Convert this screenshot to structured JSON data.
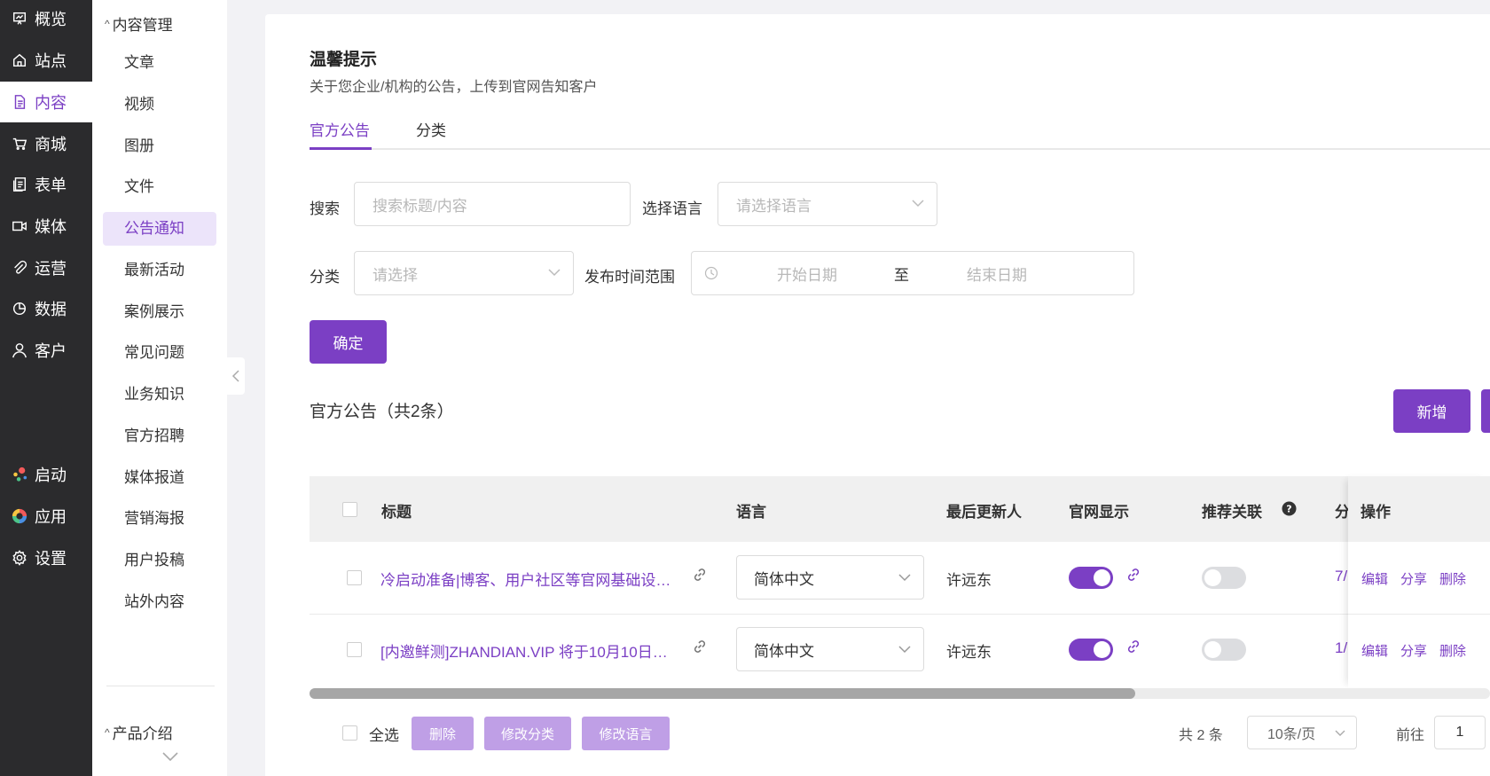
{
  "nav": {
    "items": [
      {
        "label": "概览",
        "icon": "presentation-icon"
      },
      {
        "label": "站点",
        "icon": "home-icon"
      },
      {
        "label": "内容",
        "icon": "document-icon"
      },
      {
        "label": "商城",
        "icon": "cart-icon"
      },
      {
        "label": "表单",
        "icon": "form-icon"
      },
      {
        "label": "媒体",
        "icon": "video-camera-icon"
      },
      {
        "label": "运营",
        "icon": "paperclip-icon"
      },
      {
        "label": "数据",
        "icon": "pie-chart-icon"
      },
      {
        "label": "客户",
        "icon": "user-icon"
      },
      {
        "label": "启动",
        "icon": "launch-dots-icon"
      },
      {
        "label": "应用",
        "icon": "apps-color-wheel-icon"
      },
      {
        "label": "设置",
        "icon": "gear-icon"
      }
    ],
    "active_index": 2,
    "accent": "#7b3fc4"
  },
  "submenu": {
    "group1": "内容管理",
    "items": [
      "文章",
      "视频",
      "图册",
      "文件",
      "公告通知",
      "最新活动",
      "案例展示",
      "常见问题",
      "业务知识",
      "官方招聘",
      "媒体报道",
      "营销海报",
      "用户投稿",
      "站外内容"
    ],
    "active_index": 4,
    "group2": "产品介绍"
  },
  "header": {
    "title": "温馨提示",
    "subtitle": "关于您企业/机构的公告，上传到官网告知客户"
  },
  "tabs": [
    {
      "label": "官方公告",
      "active": true
    },
    {
      "label": "分类",
      "active": false
    }
  ],
  "filters": {
    "search_label": "搜索",
    "search_placeholder": "搜索标题/内容",
    "language_label": "选择语言",
    "language_placeholder": "请选择语言",
    "category_label": "分类",
    "category_placeholder": "请选择",
    "date_label": "发布时间范围",
    "start_placeholder": "开始日期",
    "date_sep": "至",
    "end_placeholder": "结束日期",
    "confirm": "确定"
  },
  "list": {
    "title": "官方公告（共2条）",
    "add_button": "新增"
  },
  "table": {
    "columns": [
      "标题",
      "语言",
      "最后更新人",
      "官网显示",
      "推荐关联",
      "分",
      "操作"
    ],
    "rows": [
      {
        "title": "冷启动准备|博客、用户社区等官网基础设…",
        "language": "简体中文",
        "updater": "许远东",
        "site_visible": true,
        "recommend": false,
        "category_partial": "7/",
        "ops": [
          "编辑",
          "分享",
          "删除"
        ]
      },
      {
        "title": "[内邀鲜测]ZHANDIAN.VIP 将于10月10日…",
        "language": "简体中文",
        "updater": "许远东",
        "site_visible": true,
        "recommend": false,
        "category_partial": "1/",
        "ops": [
          "编辑",
          "分享",
          "删除"
        ]
      }
    ]
  },
  "footer": {
    "select_all": "全选",
    "delete": "删除",
    "edit_category": "修改分类",
    "edit_language": "修改语言",
    "total": "共 2 条",
    "page_size": "10条/页",
    "goto_label": "前往",
    "page": "1"
  }
}
